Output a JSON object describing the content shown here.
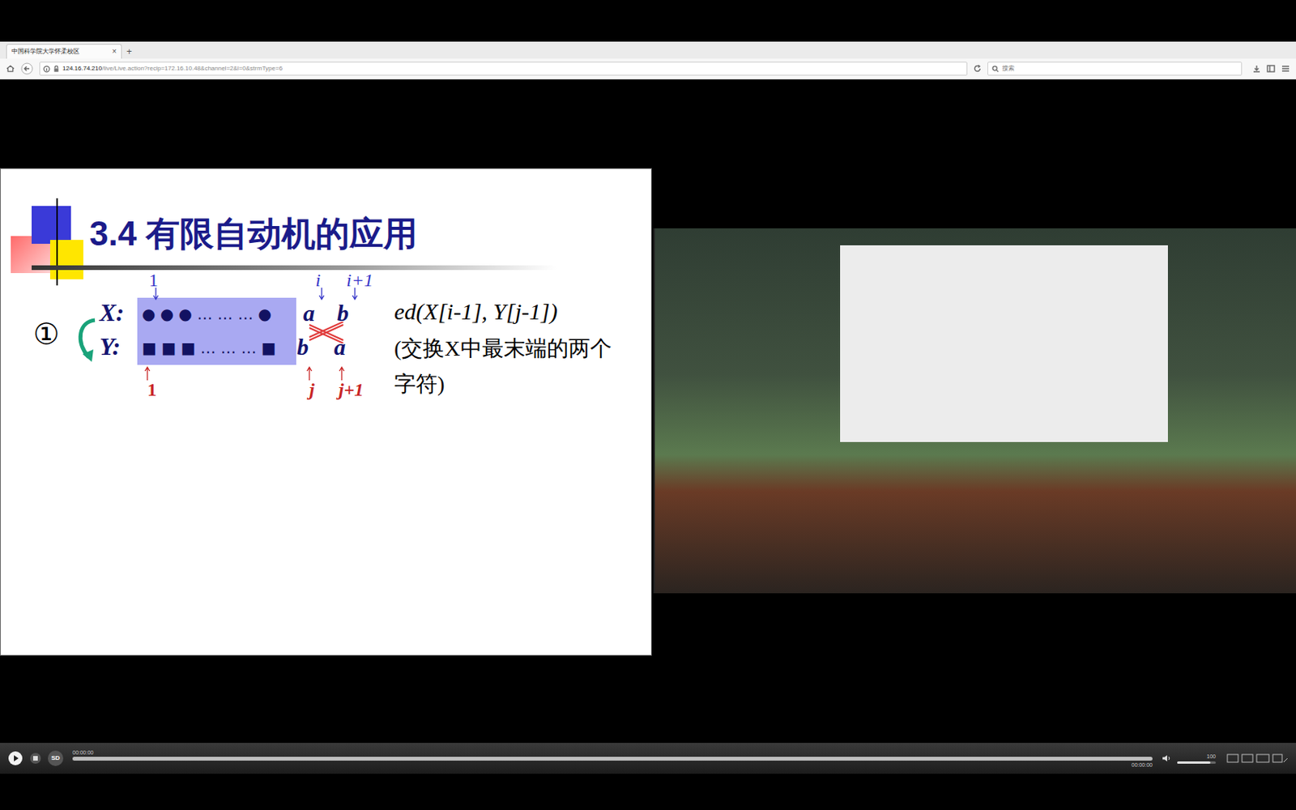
{
  "browser": {
    "tab": {
      "title": "中国科学院大学怀柔校区",
      "close": "×",
      "selected": true
    },
    "new_tab": "+",
    "url": {
      "host": "124.16.74.210",
      "path": "/live/Live.action?recip=172.16.10.48&channel=2&l=0&strmType=6"
    },
    "search": {
      "placeholder": "搜索"
    }
  },
  "slide": {
    "title": "3.4 有限自动机的应用",
    "number": "①",
    "rows": [
      {
        "label": "X:",
        "symbols": "● ● ● … … … ●",
        "end": [
          "a",
          "b"
        ]
      },
      {
        "label": "Y:",
        "symbols": "■ ■ ■ … … … ■",
        "end": [
          "b",
          "a"
        ]
      }
    ],
    "top_labels": [
      "1",
      "i",
      "i+1"
    ],
    "bottom_labels": [
      "1",
      "j",
      "j+1"
    ],
    "formula": "ed(X[i-1], Y[j-1])",
    "note": "(交换X中最末端的两个字符)"
  },
  "player": {
    "quality": "SD",
    "time_start": "00:00:00",
    "time_end": "00:00:00",
    "progress": {
      "level": 0.0
    },
    "volume": {
      "label": "100",
      "level": 0.85
    }
  }
}
